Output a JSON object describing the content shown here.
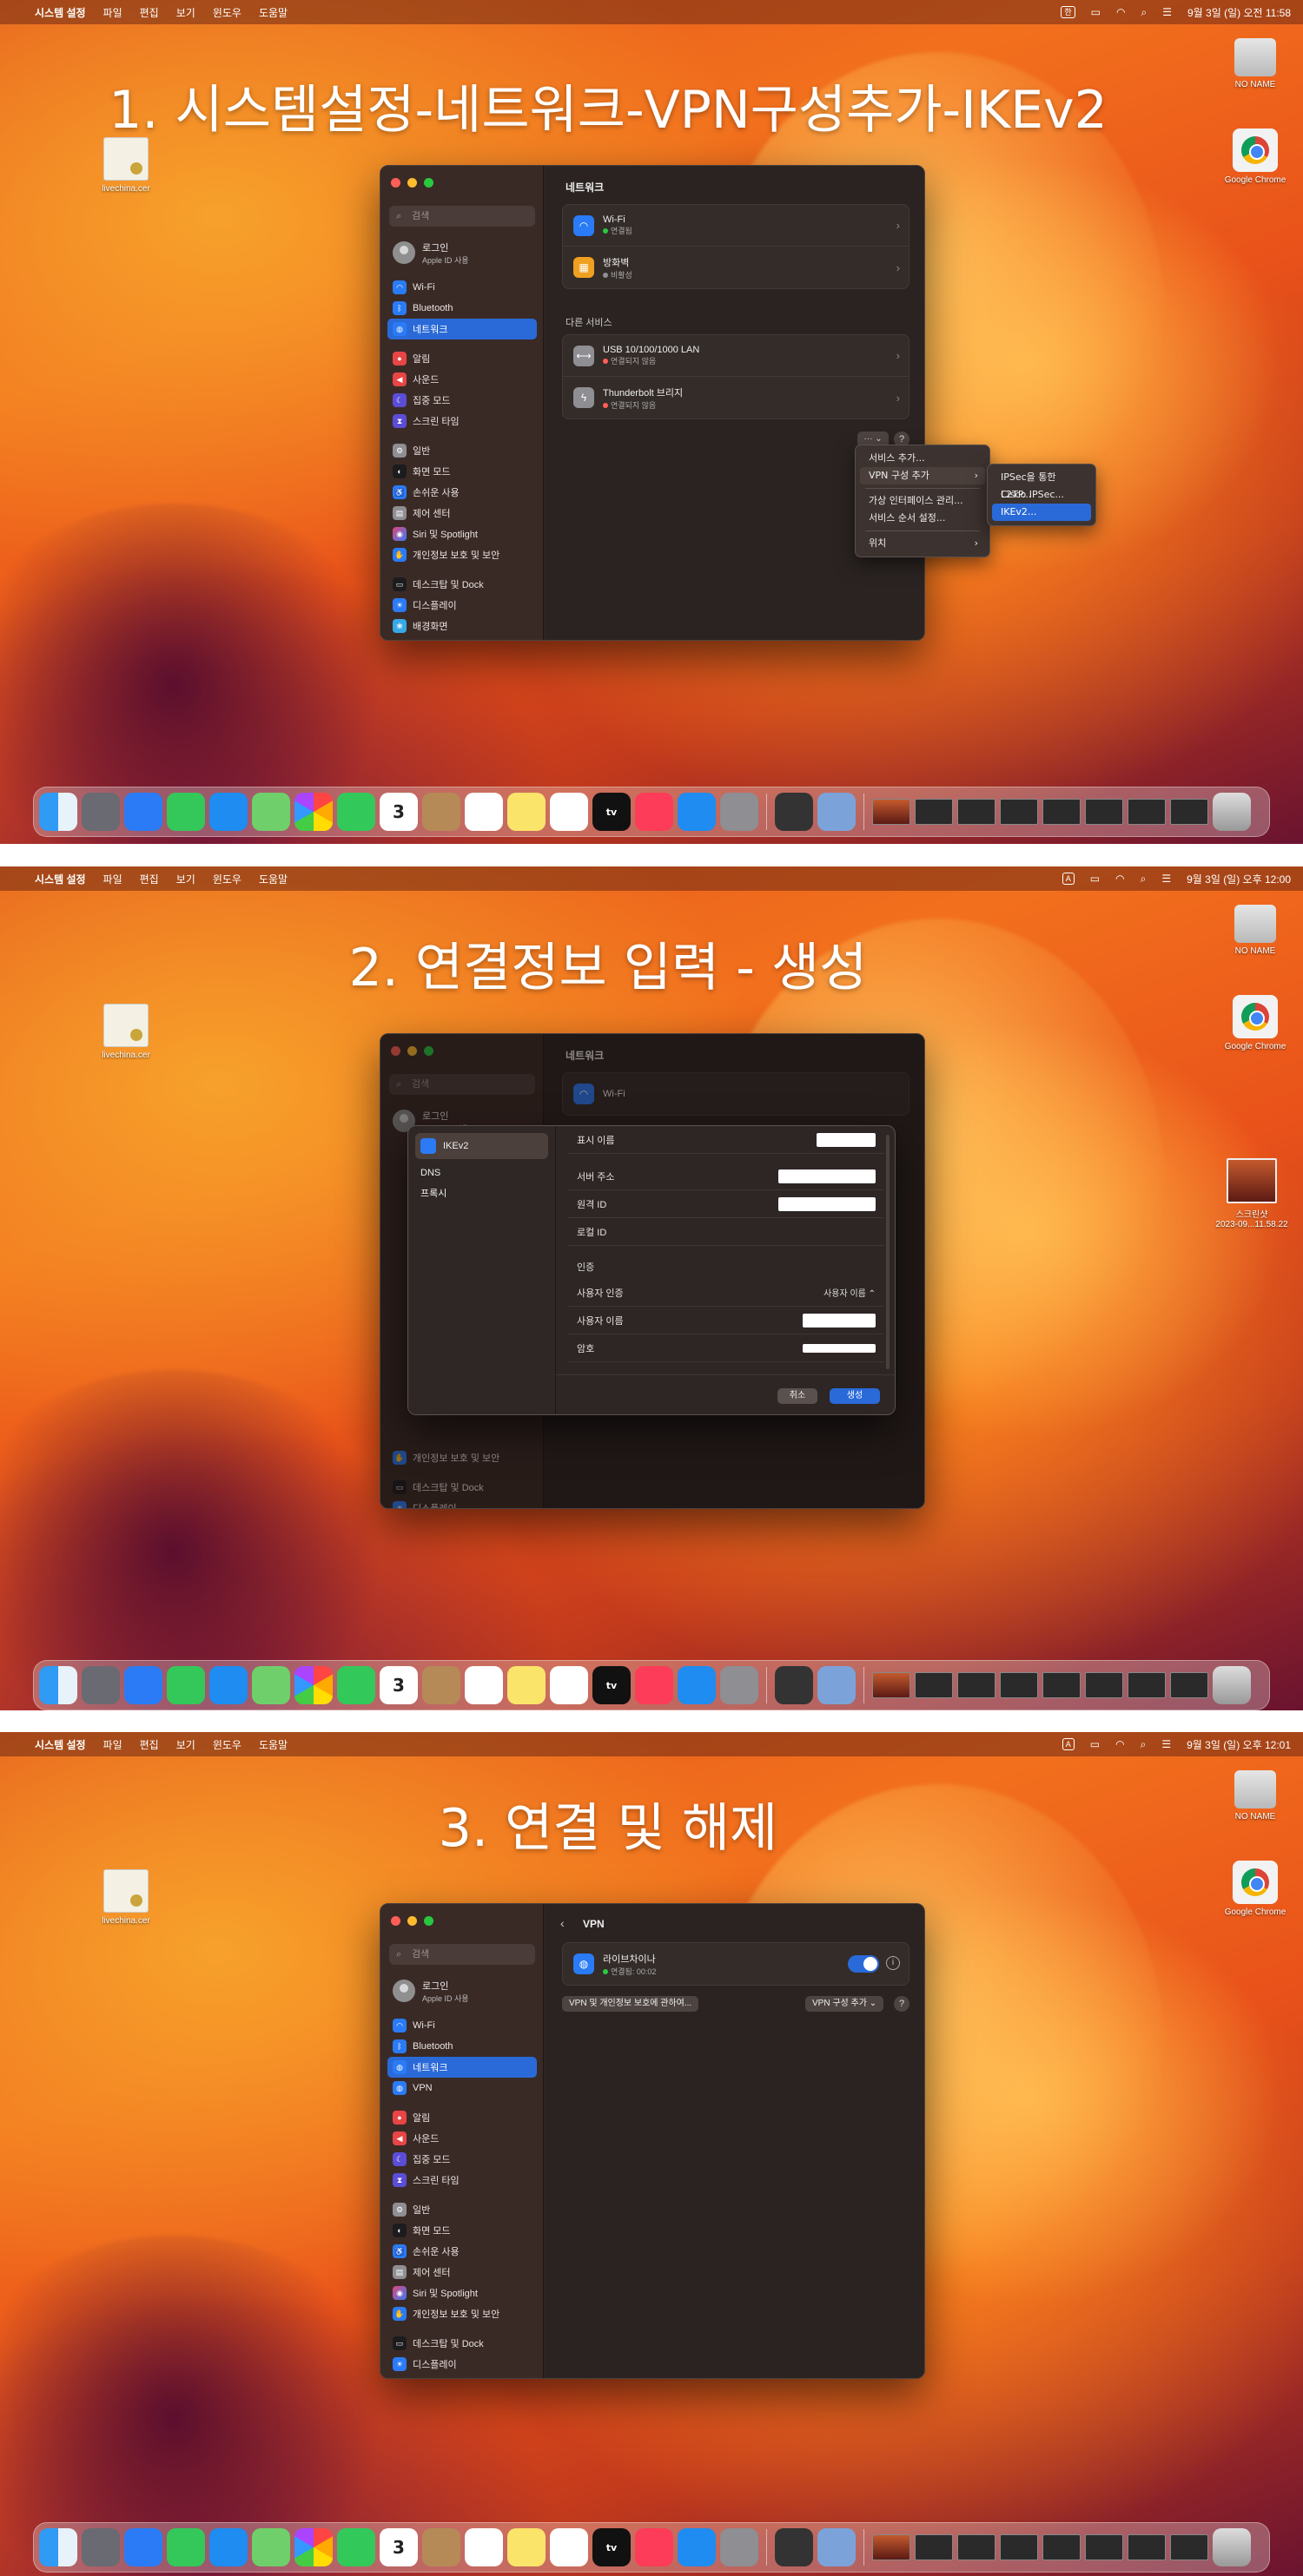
{
  "menubar": {
    "app": "시스템 설정",
    "items": [
      "파일",
      "편집",
      "보기",
      "윈도우",
      "도움말"
    ],
    "status_kb": "한",
    "status_kb_2": "A"
  },
  "shots": [
    {
      "heading": "1. 시스템설정-네트워크-VPN구성추가-IKEv2",
      "clock": "9월 3일 (일) 오전 11:58"
    },
    {
      "heading": "2. 연결정보 입력 - 생성",
      "clock": "9월 3일 (일) 오후 12:00"
    },
    {
      "heading": "3. 연결 및 해제",
      "clock": "9월 3일 (일) 오후 12:01"
    }
  ],
  "desktop": {
    "cert": "livechina.cer",
    "disk": "NO NAME",
    "chrome": "Google Chrome",
    "screenshot_line1": "스크린샷",
    "screenshot_line2": "2023-09...11.58.22"
  },
  "sidebar": {
    "search_placeholder": "검색",
    "account_name": "로그인",
    "account_sub": "Apple ID 사용",
    "wifi": "Wi-Fi",
    "bluetooth": "Bluetooth",
    "network": "네트워크",
    "vpn": "VPN",
    "notifications": "알림",
    "sound": "사운드",
    "focus": "집중 모드",
    "screen_time": "스크린 타임",
    "general": "일반",
    "appearance": "화면 모드",
    "accessibility": "손쉬운 사용",
    "control_center": "제어 센터",
    "siri": "Siri 및 Spotlight",
    "privacy": "개인정보 보호 및 보안",
    "desktop_dock": "데스크탑 및 Dock",
    "displays": "디스플레이",
    "wallpaper": "배경화면"
  },
  "network": {
    "title": "네트워크",
    "wifi_name": "Wi-Fi",
    "wifi_status": "연결됨",
    "firewall_name": "방화벽",
    "firewall_status": "비활성",
    "other_services": "다른 서비스",
    "usb_name": "USB 10/100/1000 LAN",
    "usb_status": "연결되지 않음",
    "tb_name": "Thunderbolt 브리지",
    "tb_status": "연결되지 않음",
    "more_btn": "··· ⌄",
    "help": "?"
  },
  "context_menu": {
    "add_service": "서비스 추가...",
    "add_vpn": "VPN 구성 추가",
    "virtual_iface": "가상 인터페이스 관리...",
    "service_order": "서비스 순서 설정...",
    "location": "위치",
    "sub_l2tp": "IPSec을 통한 L2TP...",
    "sub_cisco": "Cisco IPSec...",
    "sub_ikev2": "IKEv2..."
  },
  "dialog": {
    "type": "IKEv2",
    "dns": "DNS",
    "proxy": "프록시",
    "display_name": "표시 이름",
    "server": "서버 주소",
    "remote_id": "원격 ID",
    "local_id": "로컬 ID",
    "auth_section": "인증",
    "user_auth": "사용자 인증",
    "user_auth_value": "사용자 이름 ⌃",
    "username": "사용자 이름",
    "password": "암호",
    "cancel": "취소",
    "create": "생성"
  },
  "vpn": {
    "back": "‹",
    "title": "VPN",
    "conn_name": "라이브차이나",
    "conn_status": "연결됨: 00:02",
    "manage_btn": "VPN 및 개인정보 보호에 관하여...",
    "add_btn": "VPN 구성 추가 ⌄",
    "help": "?"
  },
  "dock_calendar": "3",
  "dock_tv": "tv",
  "colors": {
    "accent": "#2a6ad8",
    "green": "#2bc840",
    "red": "#ff5f57"
  }
}
